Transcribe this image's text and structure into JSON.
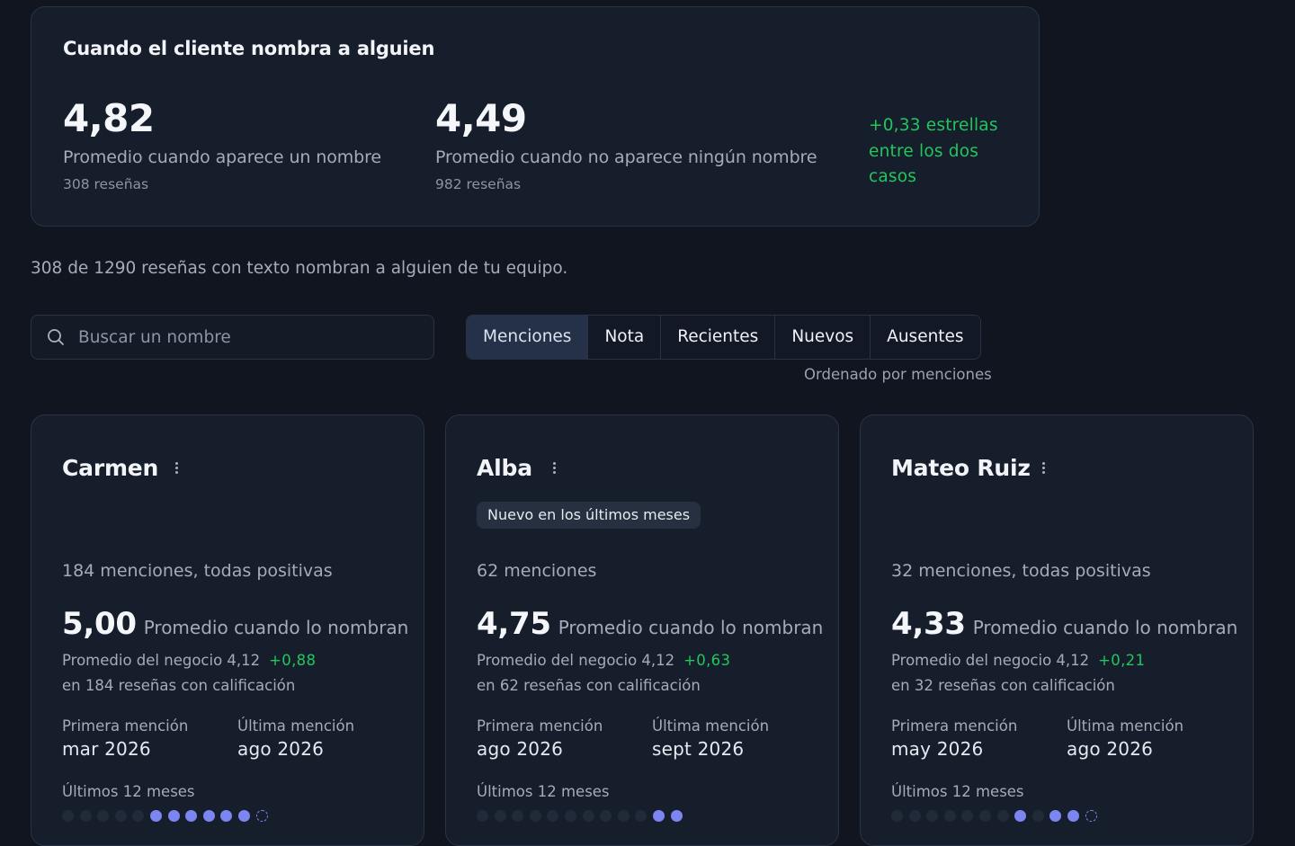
{
  "summary": {
    "title": "Cuando el cliente nombra a alguien",
    "with_name": {
      "value": "4,82",
      "label": "Promedio cuando aparece un nombre",
      "reviews": "308 reseñas"
    },
    "without_name": {
      "value": "4,49",
      "label": "Promedio cuando no aparece ningún nombre",
      "reviews": "982 reseñas"
    },
    "difference": "+0,33 estrellas entre los dos casos",
    "accent_color": "#22c55e"
  },
  "intro": "308 de 1290 reseñas con texto nombran a alguien de tu equipo.",
  "search": {
    "placeholder": "Buscar un nombre",
    "icon": "search-icon"
  },
  "tabs": {
    "items": [
      {
        "label": "Menciones",
        "active": true
      },
      {
        "label": "Nota",
        "active": false
      },
      {
        "label": "Recientes",
        "active": false
      },
      {
        "label": "Nuevos",
        "active": false
      },
      {
        "label": "Ausentes",
        "active": false
      }
    ],
    "sort_note": "Ordenado por menciones"
  },
  "cards": [
    {
      "name": "Carmen",
      "badge": null,
      "mentions": "184 menciones, todas positivas",
      "avg": "5,00",
      "avg_label": "Promedio cuando lo nombran",
      "business_avg": "Promedio del negocio 4,12",
      "delta": "+0,88",
      "based_on": "en 184 reseñas con calificación",
      "first_label": "Primera mención",
      "first_value": "mar 2026",
      "last_label": "Última mención",
      "last_value": "ago 2026",
      "months_label": "Últimos 12 meses",
      "months": [
        0,
        0,
        0,
        0,
        0,
        1,
        1,
        1,
        1,
        1,
        1,
        2
      ]
    },
    {
      "name": "Alba",
      "badge": "Nuevo en los últimos meses",
      "mentions": "62 menciones",
      "avg": "4,75",
      "avg_label": "Promedio cuando lo nombran",
      "business_avg": "Promedio del negocio 4,12",
      "delta": "+0,63",
      "based_on": "en 62 reseñas con calificación",
      "first_label": "Primera mención",
      "first_value": "ago 2026",
      "last_label": "Última mención",
      "last_value": "sept 2026",
      "months_label": "Últimos 12 meses",
      "months": [
        0,
        0,
        0,
        0,
        0,
        0,
        0,
        0,
        0,
        0,
        1,
        1
      ]
    },
    {
      "name": "Mateo Ruiz",
      "badge": null,
      "mentions": "32 menciones, todas positivas",
      "avg": "4,33",
      "avg_label": "Promedio cuando lo nombran",
      "business_avg": "Promedio del negocio 4,12",
      "delta": "+0,21",
      "based_on": "en 32 reseñas con calificación",
      "first_label": "Primera mención",
      "first_value": "may 2026",
      "last_label": "Última mención",
      "last_value": "ago 2026",
      "months_label": "Últimos 12 meses",
      "months": [
        0,
        0,
        0,
        0,
        0,
        0,
        0,
        1,
        0,
        1,
        1,
        2
      ]
    }
  ]
}
